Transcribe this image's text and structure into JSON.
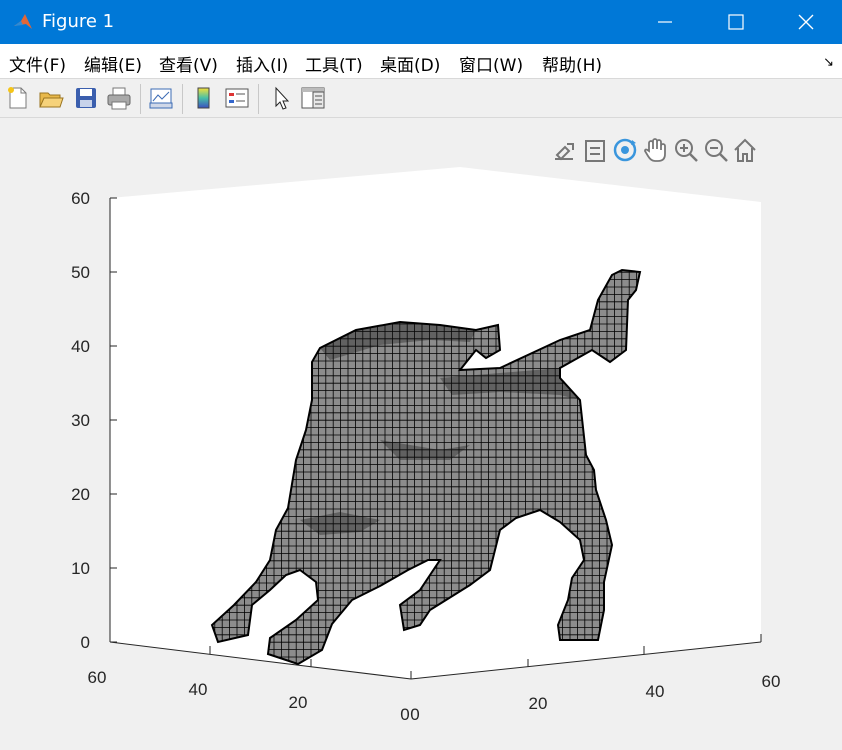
{
  "window": {
    "title": "Figure 1"
  },
  "menu": [
    "文件(F)",
    "编辑(E)",
    "查看(V)",
    "插入(I)",
    "工具(T)",
    "桌面(D)",
    "窗口(W)",
    "帮助(H)"
  ],
  "toolbar": [
    "new-figure-icon",
    "open-file-icon",
    "save-icon",
    "print-icon",
    "link-plot-icon",
    "insert-colorbar-icon",
    "insert-legend-icon",
    "edit-plot-arrow-icon",
    "property-inspector-icon"
  ],
  "axes_toolbar": [
    "brush-export-icon",
    "data-tips-icon",
    "rotate-3d-icon",
    "pan-hand-icon",
    "zoom-in-icon",
    "zoom-out-icon",
    "restore-view-home-icon"
  ],
  "axes": {
    "z_ticks": [
      "0",
      "10",
      "20",
      "30",
      "40",
      "50",
      "60"
    ],
    "x_ticks": [
      "0",
      "20",
      "40",
      "60"
    ],
    "y_ticks": [
      "0",
      "20",
      "40",
      "60"
    ],
    "zlim": [
      0,
      60
    ],
    "xlim": [
      0,
      60
    ],
    "ylim": [
      0,
      60
    ],
    "view": "3-D voxel plot",
    "voxel_face_color": "#8c8c8c",
    "voxel_edge_color": "#000000"
  }
}
